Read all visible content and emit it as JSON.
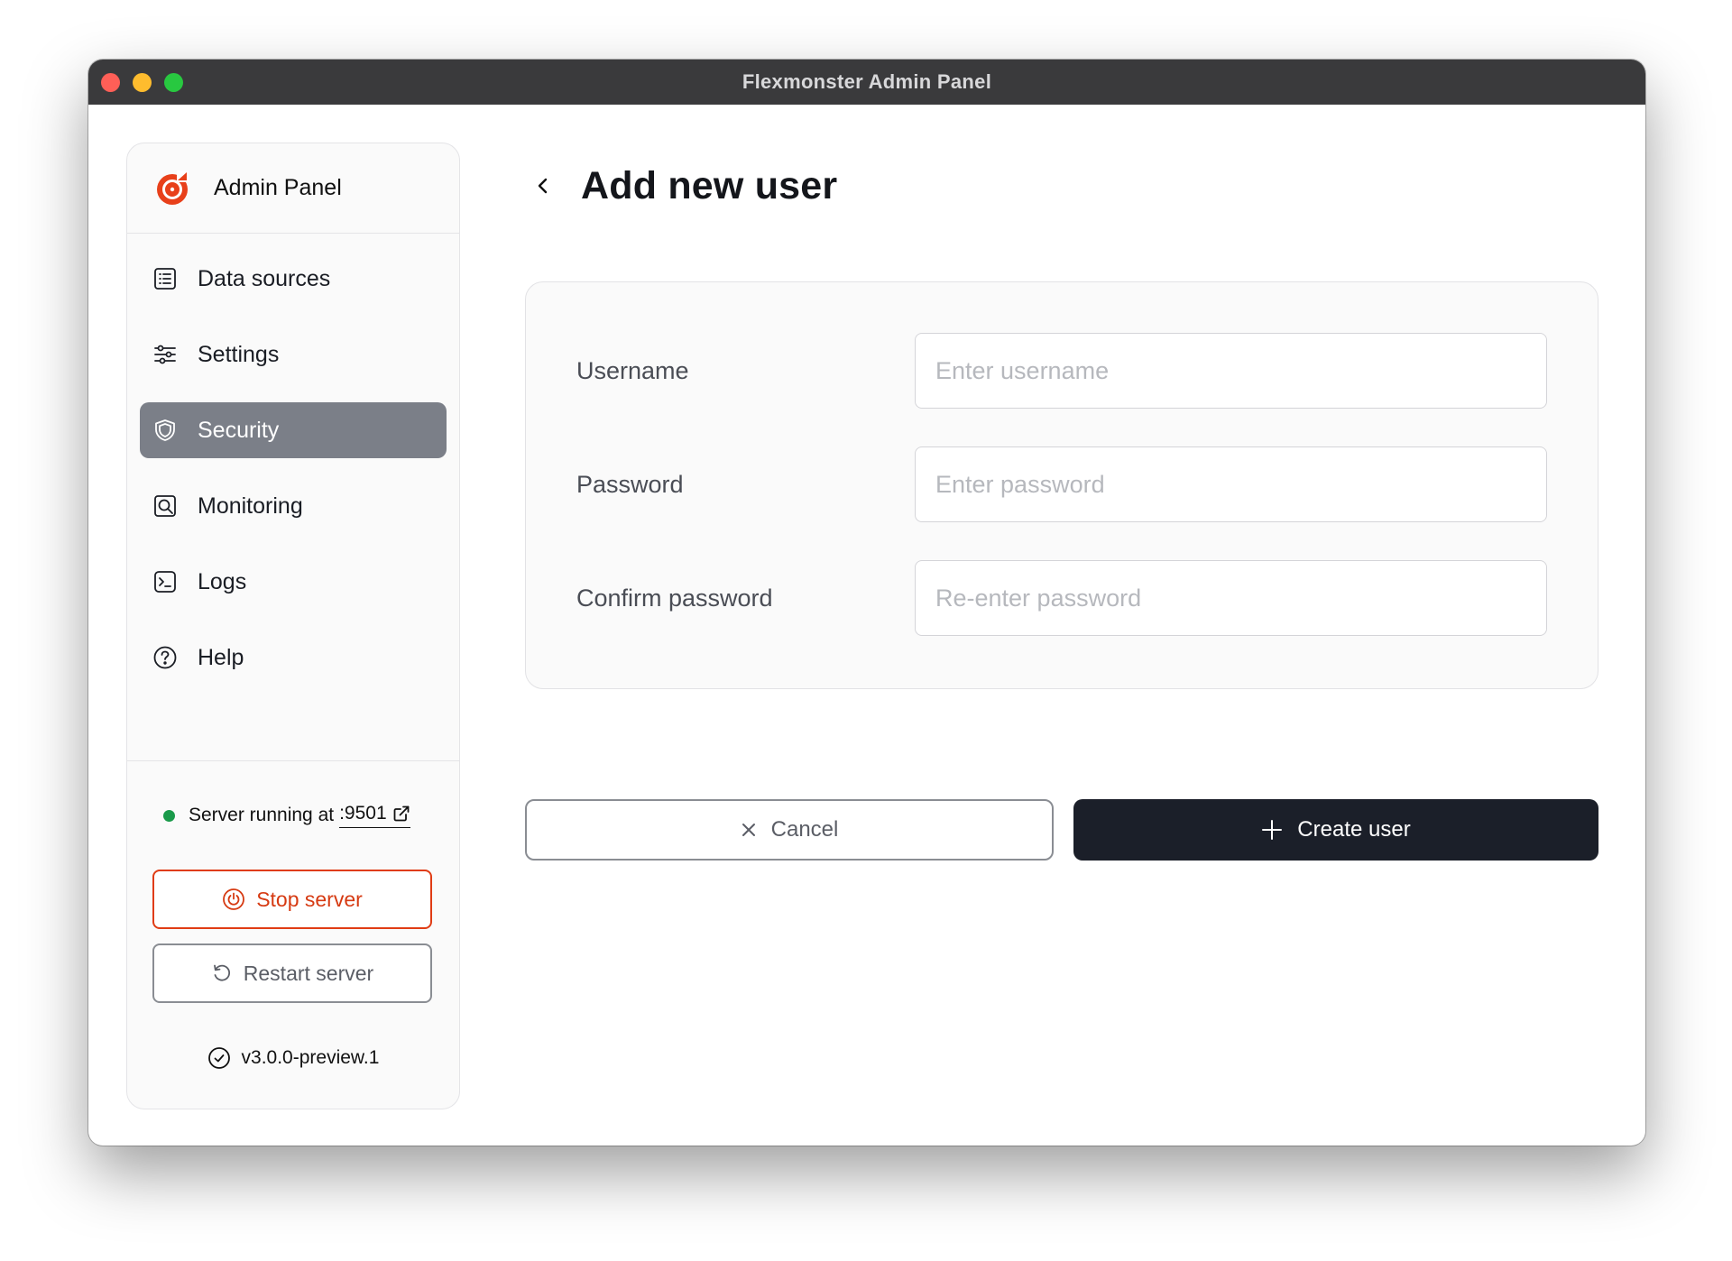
{
  "window": {
    "title": "Flexmonster Admin Panel"
  },
  "brand": {
    "title": "Admin Panel",
    "accent": "#e8401a"
  },
  "sidebar": {
    "items": [
      {
        "label": "Data sources",
        "icon": "list-icon",
        "active": false
      },
      {
        "label": "Settings",
        "icon": "sliders-icon",
        "active": false
      },
      {
        "label": "Security",
        "icon": "shield-icon",
        "active": true
      },
      {
        "label": "Monitoring",
        "icon": "monitor-search-icon",
        "active": false
      },
      {
        "label": "Logs",
        "icon": "terminal-icon",
        "active": false
      },
      {
        "label": "Help",
        "icon": "help-icon",
        "active": false
      }
    ]
  },
  "server": {
    "status_text": "Server running at",
    "port": ":9501",
    "status_color": "#1a9a4a",
    "stop_label": "Stop server",
    "restart_label": "Restart server",
    "version": "v3.0.0-preview.1"
  },
  "page": {
    "title": "Add new user"
  },
  "form": {
    "username": {
      "label": "Username",
      "placeholder": "Enter username",
      "value": ""
    },
    "password": {
      "label": "Password",
      "placeholder": "Enter password",
      "value": ""
    },
    "confirm": {
      "label": "Confirm password",
      "placeholder": "Re-enter password",
      "value": ""
    }
  },
  "actions": {
    "cancel_label": "Cancel",
    "create_label": "Create user"
  }
}
